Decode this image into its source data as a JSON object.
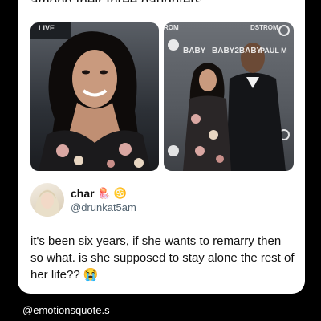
{
  "post": {
    "preceding_text": "among their three daughters.",
    "author": {
      "display_name": "char",
      "emoji_1": "🪼",
      "emoji_2": "♋",
      "handle": "@drunkat5am"
    },
    "body": "it's been six years, if she wants to remarry then so what. is she supposed to stay alone the rest of her life?? 😭",
    "media": {
      "left_backdrop_text": "LIVE",
      "right_backdrop_text_1": "ROM",
      "right_backdrop_text_2": "DSTROM",
      "right_backdrop_text_3": "BABY",
      "right_backdrop_text_4": "BABY2BABY",
      "right_backdrop_text_5": "PAUL M"
    }
  },
  "watermark": "@emotionsquote.s",
  "colors": {
    "background": "#000000",
    "card": "#ffffff",
    "handle": "#536471"
  }
}
